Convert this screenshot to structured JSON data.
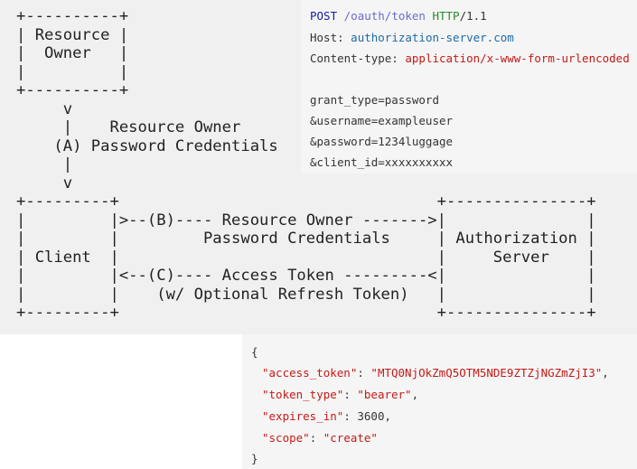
{
  "ascii_diagram": {
    "lines": [
      "+----------+",
      "| Resource |",
      "|  Owner   |",
      "|          |",
      "+----------+",
      "     v",
      "     |    Resource Owner",
      "    (A) Password Credentials",
      "     |",
      "     v",
      "+---------+                                  +---------------+",
      "|         |>--(B)---- Resource Owner ------->|               |",
      "|         |         Password Credentials     | Authorization |",
      "| Client  |                                  |     Server    |",
      "|         |<--(C)---- Access Token ---------<|               |",
      "|         |    (w/ Optional Refresh Token)   |               |",
      "+---------+                                  +---------------+"
    ]
  },
  "http_request": {
    "method": "POST",
    "path": "/oauth/token",
    "protocol": "HTTP",
    "version": "/1.1",
    "host_label": "Host:",
    "host_value": "authorization-server.com",
    "content_type_label": "Content-type:",
    "content_type_value": "application/x-www-form-urlencoded",
    "body_lines": [
      "grant_type=password",
      "&username=exampleuser",
      "&password=1234luggage",
      "&client_id=xxxxxxxxxx"
    ]
  },
  "json_response": {
    "open_brace": "{",
    "close_brace": "}",
    "fields": [
      {
        "key": "\"access_token\"",
        "sep": ": ",
        "value": "\"MTQ0NjOkZmQ5OTM5NDE9ZTZjNGZmZjI3\"",
        "trail": ","
      },
      {
        "key": "\"token_type\"",
        "sep": ": ",
        "value": "\"bearer\"",
        "trail": ","
      },
      {
        "key": "\"expires_in\"",
        "sep": ": ",
        "value": "3600",
        "trail": ","
      },
      {
        "key": "\"scope\"",
        "sep": ": ",
        "value": "\"create\"",
        "trail": ""
      }
    ]
  }
}
